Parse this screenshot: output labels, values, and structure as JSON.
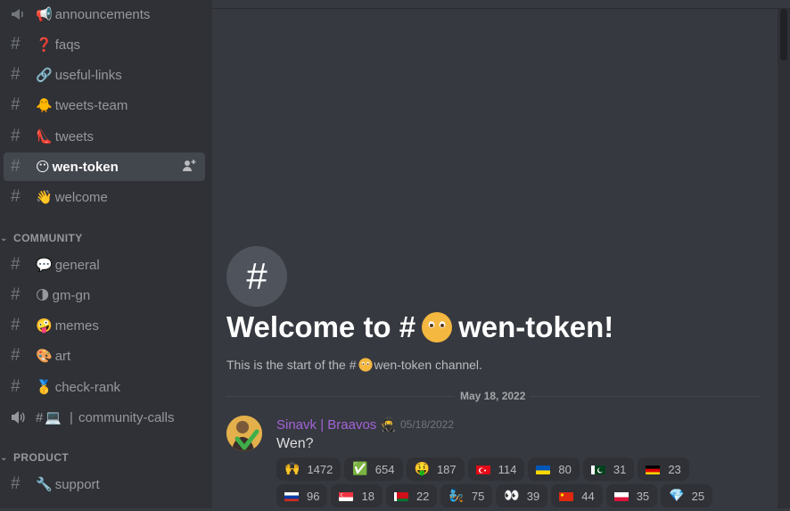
{
  "sidebar": {
    "channels_top": [
      {
        "name": "announcements",
        "emoji": "📢"
      },
      {
        "name": "faqs",
        "emoji": "❓"
      },
      {
        "name": "useful-links",
        "emoji": "🔗"
      },
      {
        "name": "tweets-team",
        "emoji": "🐥"
      },
      {
        "name": "tweets",
        "emoji": "👠"
      },
      {
        "name": "wen-token",
        "emoji": "😶",
        "active": true
      },
      {
        "name": "welcome",
        "emoji": "👋"
      }
    ],
    "category_community": "COMMUNITY",
    "channels_community": [
      {
        "name": "general",
        "emoji": "💬"
      },
      {
        "name": "gm-gn",
        "emoji": "🌗"
      },
      {
        "name": "memes",
        "emoji": "🤪"
      },
      {
        "name": "art",
        "emoji": "🎨"
      },
      {
        "name": "check-rank",
        "emoji": "🥇"
      }
    ],
    "voice_channel": {
      "prefix": "#",
      "emoji": "💻",
      "separator": "|",
      "name": "community-calls"
    },
    "category_product": "PRODUCT",
    "channels_product": [
      {
        "name": "support",
        "emoji": "🔧"
      }
    ]
  },
  "main": {
    "welcome_hash": "#",
    "welcome_prefix": "Welcome to #",
    "welcome_channel": "wen-token!",
    "subtitle_prefix": "This is the start of the #",
    "subtitle_suffix": "wen-token channel.",
    "date_divider": "May 18, 2022",
    "message": {
      "author": "Sinavk | Braavos",
      "badge": "🥷",
      "timestamp": "05/18/2022",
      "text": "Wen?"
    },
    "reactions_row1": [
      {
        "emoji": "🙌",
        "count": "1472"
      },
      {
        "emoji": "✅",
        "count": "654"
      },
      {
        "emoji": "🤑",
        "count": "187"
      },
      {
        "flag": "tr",
        "count": "114"
      },
      {
        "flag": "ua",
        "count": "80"
      },
      {
        "flag": "pk",
        "count": "31"
      },
      {
        "flag": "de",
        "count": "23"
      }
    ],
    "reactions_row2": [
      {
        "flag": "ru",
        "count": "96"
      },
      {
        "flag": "sg",
        "count": "18"
      },
      {
        "flag": "by",
        "count": "22"
      },
      {
        "emoji": "🧞",
        "count": "75"
      },
      {
        "emoji": "👀",
        "count": "39"
      },
      {
        "flag": "cn",
        "count": "44"
      },
      {
        "flag": "pl",
        "count": "35"
      },
      {
        "emoji": "💎",
        "count": "25"
      }
    ]
  },
  "colors": {
    "sidebar_bg": "#2f3136",
    "main_bg": "#36393f",
    "author": "#a463d8",
    "active_channel_bg": "#42464d"
  }
}
